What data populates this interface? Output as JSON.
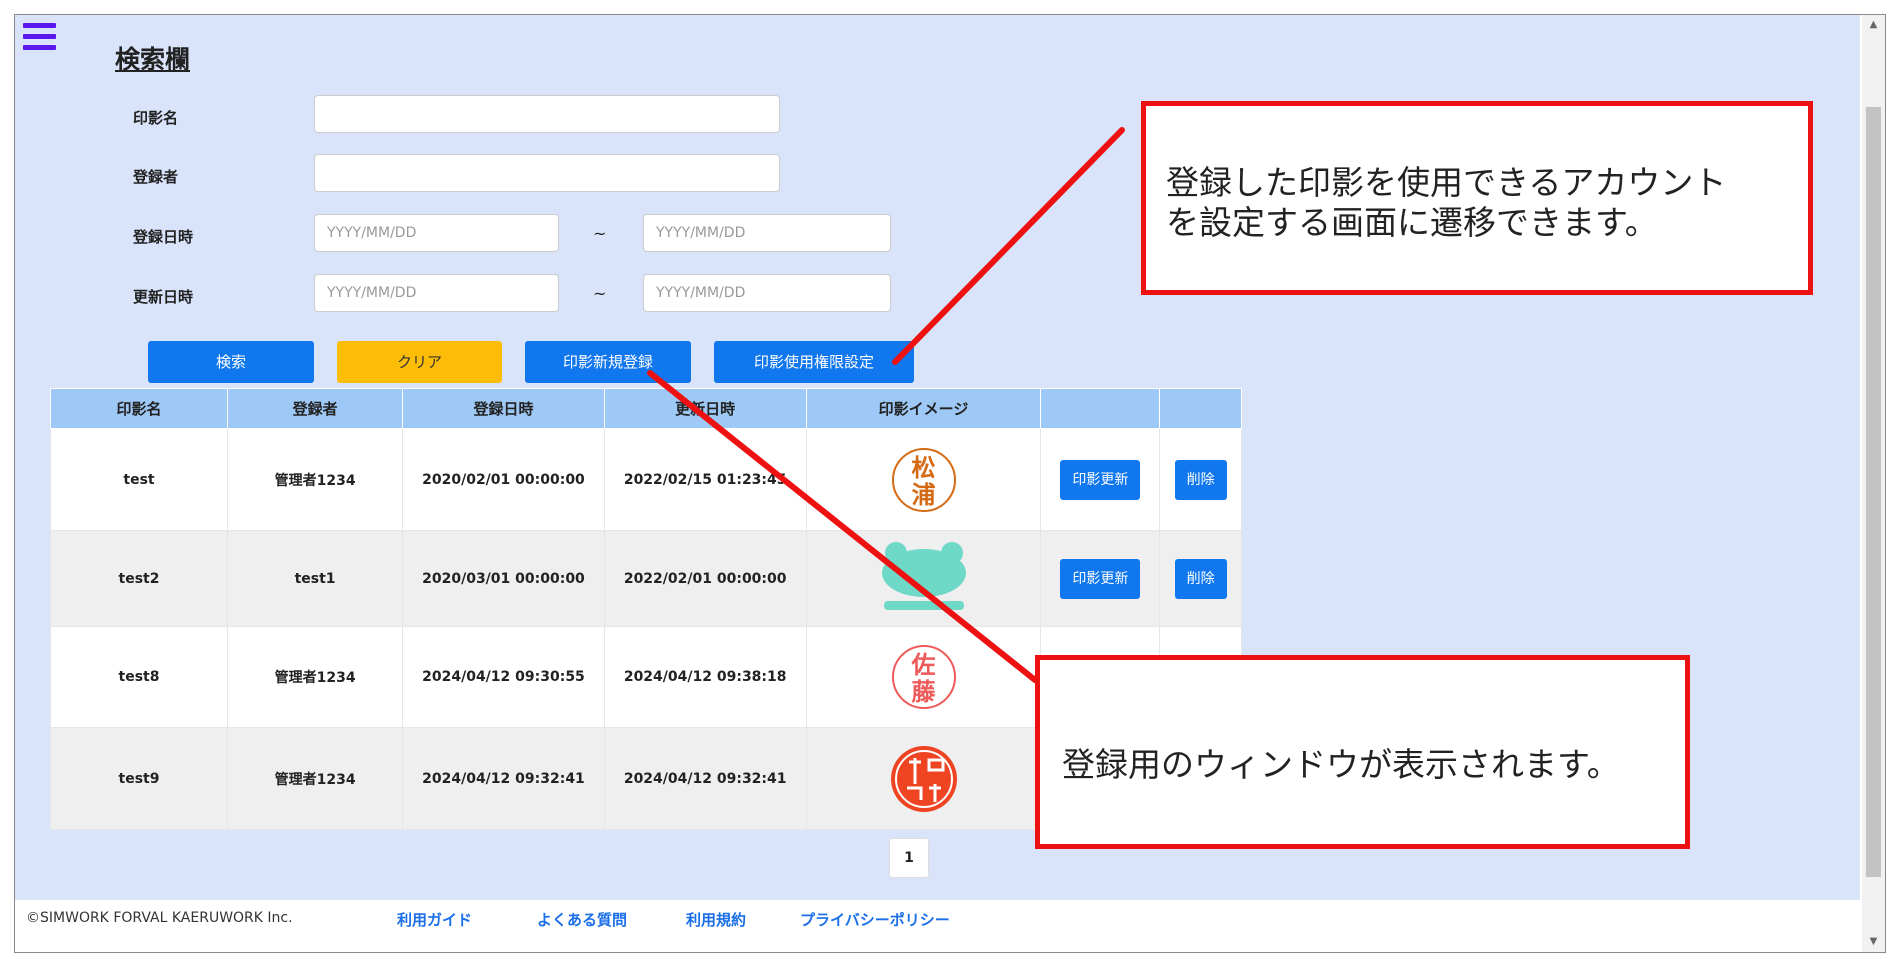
{
  "search": {
    "title": "検索欄",
    "seal_name_label": "印影名",
    "registrant_label": "登録者",
    "registered_label": "登録日時",
    "updated_label": "更新日時",
    "date_placeholder": "YYYY/MM/DD",
    "range_sep": "~"
  },
  "buttons": {
    "search": "検索",
    "clear": "クリア",
    "new_seal": "印影新規登録",
    "permission": "印影使用権限設定"
  },
  "table": {
    "headers": [
      "印影名",
      "登録者",
      "登録日時",
      "更新日時",
      "印影イメージ"
    ],
    "update_label": "印影更新",
    "delete_label": "削除",
    "rows": [
      {
        "name": "test",
        "registrant": "管理者1234",
        "registered": "2020/02/01 00:00:00",
        "updated": "2022/02/15 01:23:45",
        "stamp": [
          "松",
          "浦"
        ]
      },
      {
        "name": "test2",
        "registrant": "test1",
        "registered": "2020/03/01 00:00:00",
        "updated": "2022/02/01 00:00:00",
        "stamp": []
      },
      {
        "name": "test8",
        "registrant": "管理者1234",
        "registered": "2024/04/12 09:30:55",
        "updated": "2024/04/12 09:38:18",
        "stamp": [
          "佐",
          "藤"
        ]
      },
      {
        "name": "test9",
        "registrant": "管理者1234",
        "registered": "2024/04/12 09:32:41",
        "updated": "2024/04/12 09:32:41",
        "stamp": []
      }
    ]
  },
  "pager": {
    "current": "1"
  },
  "footer": {
    "copyright": "©SIMWORK FORVAL KAERUWORK Inc.",
    "links": [
      "利用ガイド",
      "よくある質問",
      "利用規約",
      "プライバシーポリシー"
    ]
  },
  "callouts": {
    "permission": [
      "登録した印影を使用できるアカウント",
      "を設定する画面に遷移できます。"
    ],
    "register": "登録用のウィンドウが表示されます。"
  },
  "colors": {
    "accent": "#1177ee",
    "warning": "#fdbd06",
    "callout_border": "#ee1111",
    "background": "#d9e4fb"
  }
}
